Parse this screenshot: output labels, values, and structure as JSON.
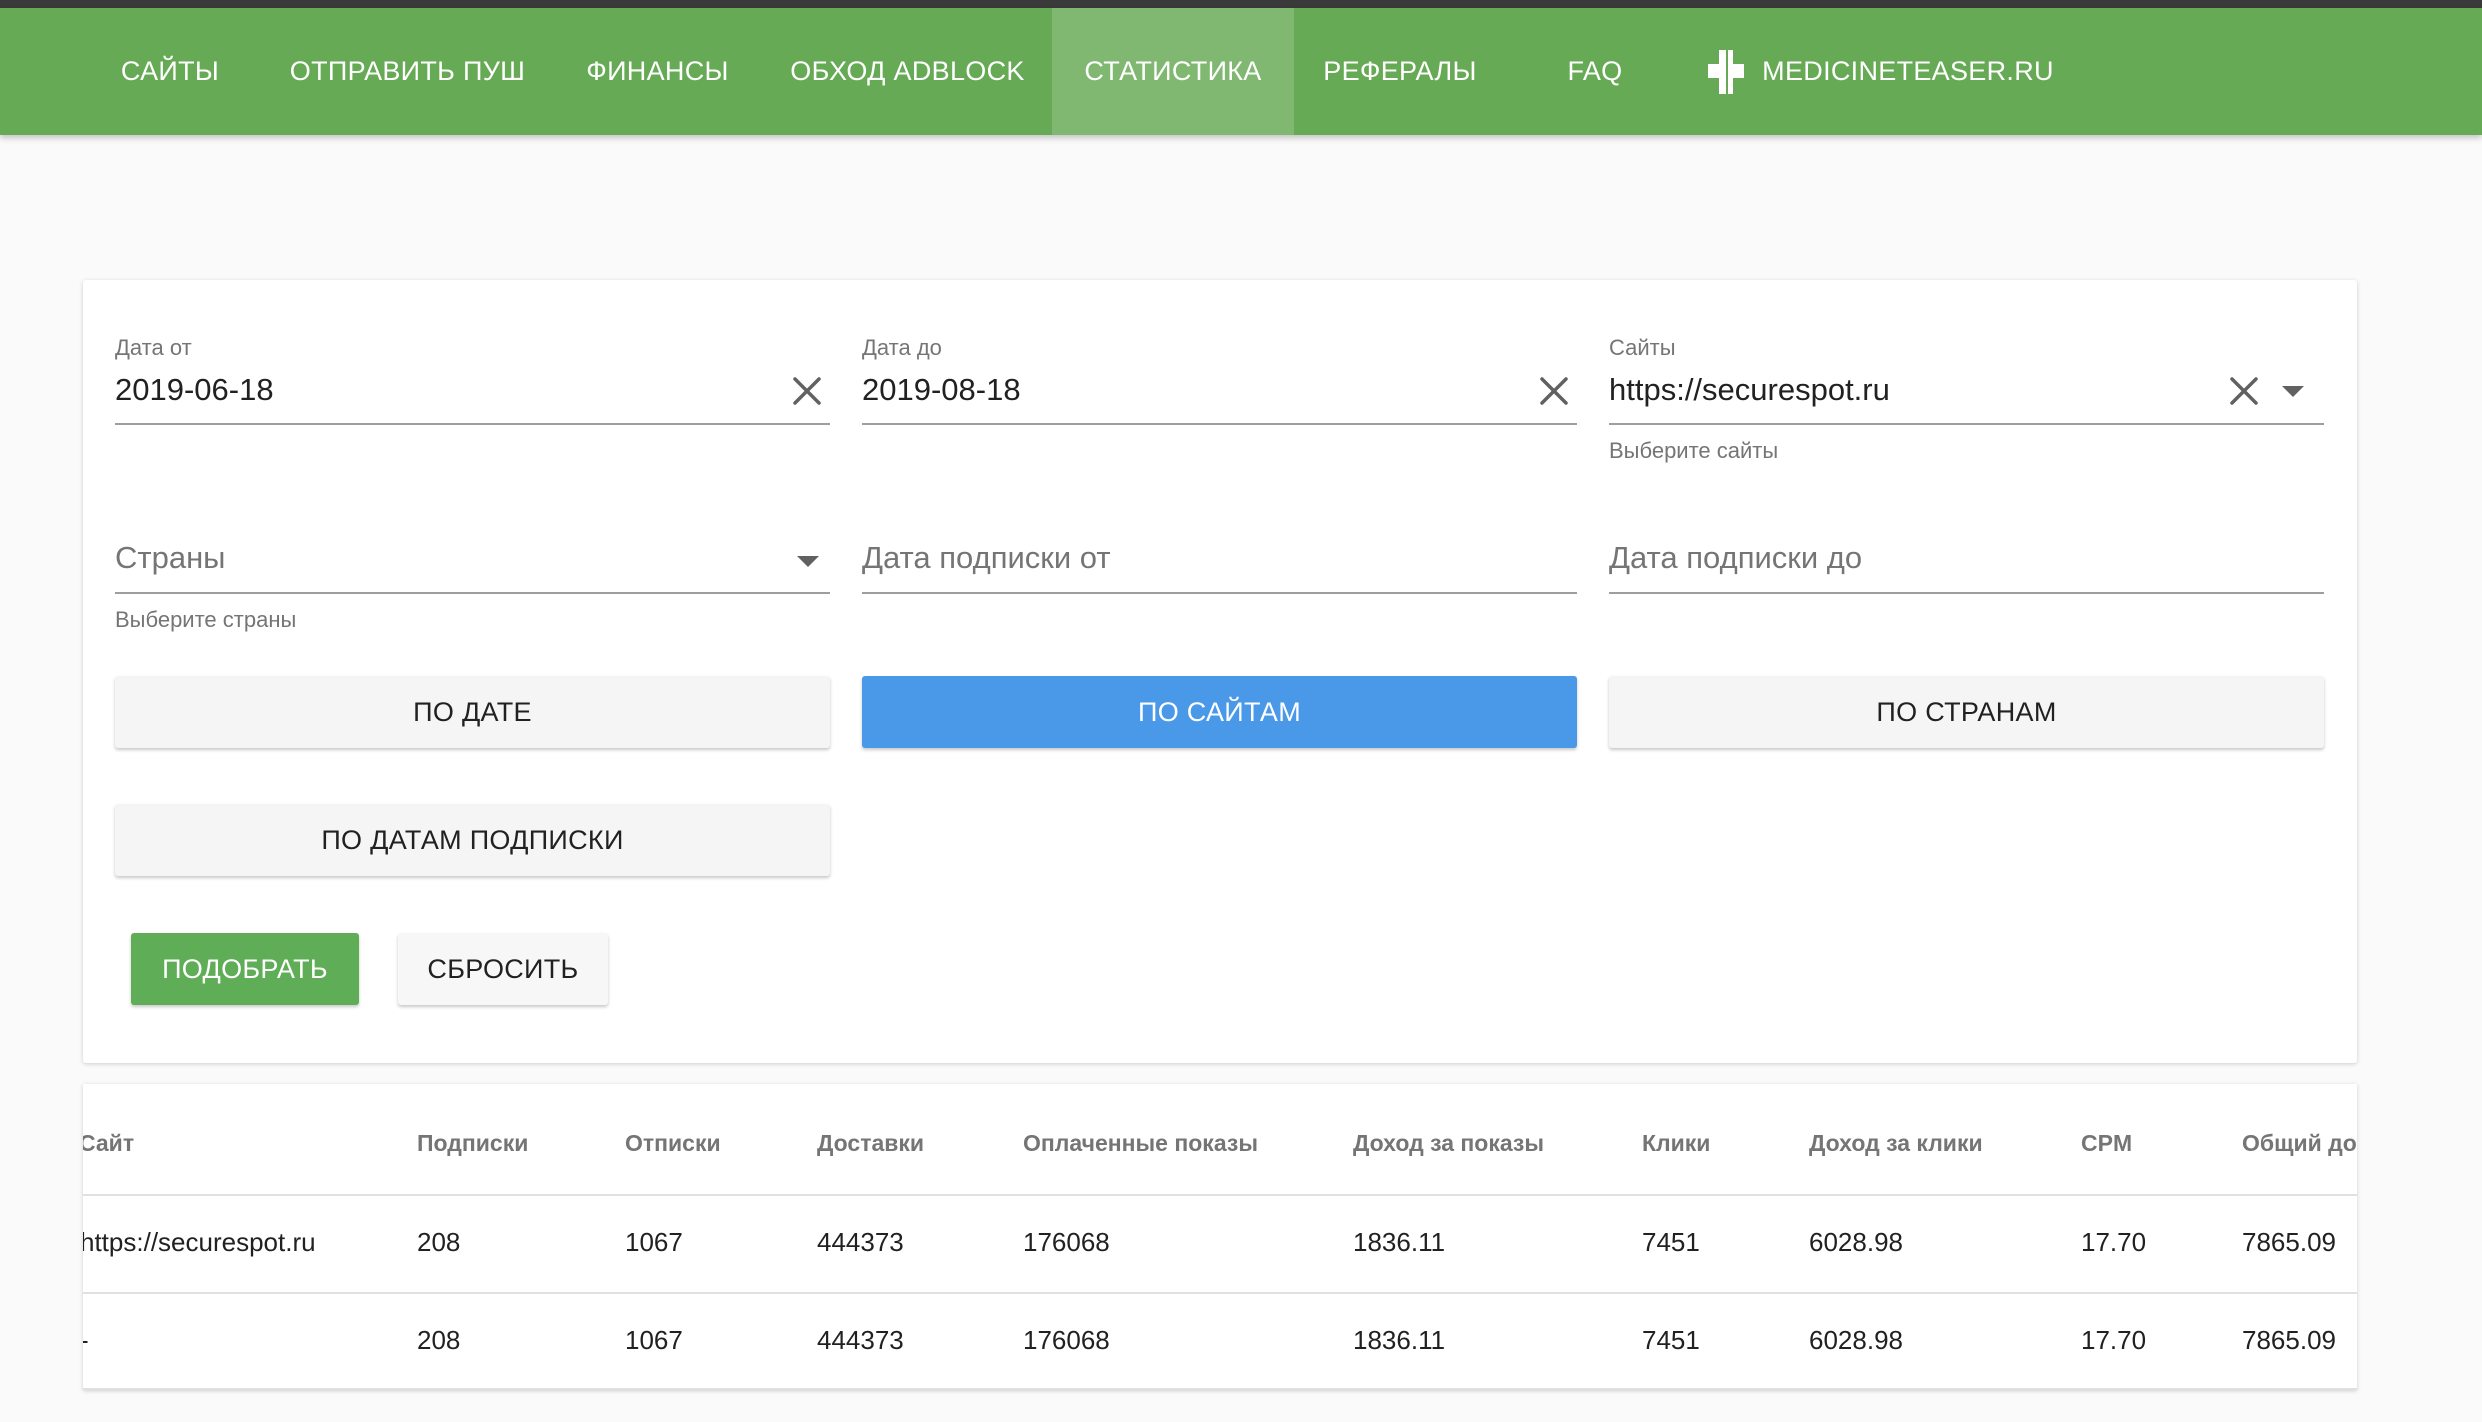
{
  "nav": {
    "items": [
      {
        "label": "САЙТЫ"
      },
      {
        "label": "ОТПРАВИТЬ ПУШ"
      },
      {
        "label": "ФИНАНСЫ"
      },
      {
        "label": "ОБХОД ADBLOCK"
      },
      {
        "label": "СТАТИСТИКА",
        "active": true
      },
      {
        "label": "РЕФЕРАЛЫ"
      },
      {
        "label": "FAQ"
      },
      {
        "label": "MEDICINETEASER.RU",
        "icon": "medical-cross-icon"
      }
    ],
    "color": "#67aa55",
    "active_color": "#80b872"
  },
  "filters": {
    "date_from": {
      "label": "Дата от",
      "value": "2019-06-18"
    },
    "date_to": {
      "label": "Дата до",
      "value": "2019-08-18"
    },
    "sites": {
      "label": "Сайты",
      "value": "https://securespot.ru",
      "hint": "Выберите сайты"
    },
    "countries": {
      "placeholder": "Страны",
      "hint": "Выберите страны"
    },
    "sub_date_from": {
      "placeholder": "Дата подписки от"
    },
    "sub_date_to": {
      "placeholder": "Дата подписки до"
    }
  },
  "group_buttons": {
    "by_date": "ПО ДАТЕ",
    "by_sites": "ПО САЙТАМ",
    "by_countries": "ПО СТРАНАМ",
    "by_sub_dates": "ПО ДАТАМ ПОДПИСКИ"
  },
  "actions": {
    "apply": "ПОДОБРАТЬ",
    "reset": "СБРОСИТЬ"
  },
  "colors": {
    "accent_blue": "#4a98e8",
    "accent_green": "#5fad56"
  },
  "table": {
    "headers": [
      "Сайт",
      "Подписки",
      "Отписки",
      "Доставки",
      "Оплаченные показы",
      "Доход за показы",
      "Клики",
      "Доход за клики",
      "CPM",
      "Общий до:"
    ],
    "rows": [
      [
        "https://securespot.ru",
        "208",
        "1067",
        "444373",
        "176068",
        "1836.11",
        "7451",
        "6028.98",
        "17.70",
        "7865.09"
      ],
      [
        "-",
        "208",
        "1067",
        "444373",
        "176068",
        "1836.11",
        "7451",
        "6028.98",
        "17.70",
        "7865.09"
      ]
    ]
  }
}
